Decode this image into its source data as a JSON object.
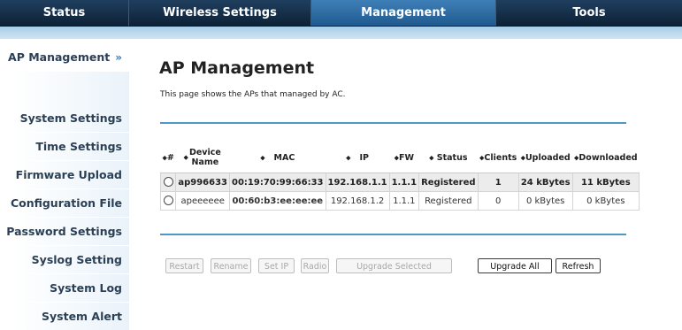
{
  "nav": {
    "tabs": [
      {
        "label": "Status"
      },
      {
        "label": "Wireless Settings"
      },
      {
        "label": "Management"
      },
      {
        "label": "Tools"
      }
    ]
  },
  "sidebar": {
    "chevron": "»",
    "items": [
      {
        "label": "AP Management"
      },
      {
        "label": "System Settings"
      },
      {
        "label": "Time Settings"
      },
      {
        "label": "Firmware Upload"
      },
      {
        "label": "Configuration File"
      },
      {
        "label": "Password Settings"
      },
      {
        "label": "Syslog Setting"
      },
      {
        "label": "System Log"
      },
      {
        "label": "System Alert"
      }
    ]
  },
  "main": {
    "title": "AP Management",
    "description": "This page shows the APs that managed by AC.",
    "sort_glyph": "◆",
    "table": {
      "headers": [
        "#",
        "Device Name",
        "MAC",
        "IP",
        "FW",
        "Status",
        "Clients",
        "Uploaded",
        "Downloaded"
      ],
      "rows": [
        {
          "device_name": "ap996633",
          "mac": "00:19:70:99:66:33",
          "ip": "192.168.1.1",
          "fw": "1.1.1",
          "status": "Registered",
          "clients": "1",
          "uploaded": "24 kBytes",
          "downloaded": "11 kBytes"
        },
        {
          "device_name": "apeeeeee",
          "mac": "00:60:b3:ee:ee:ee",
          "ip": "192.168.1.2",
          "fw": "1.1.1",
          "status": "Registered",
          "clients": "0",
          "uploaded": "0 kBytes",
          "downloaded": "0 kBytes"
        }
      ]
    },
    "buttons": {
      "restart": "Restart",
      "rename": "Rename",
      "set_ip": "Set IP",
      "radio": "Radio",
      "upgrade_selected": "Upgrade Selected",
      "upgrade_all": "Upgrade All",
      "refresh": "Refresh"
    }
  },
  "colors": {
    "nav_dark": "#0d2236",
    "nav_active": "#2f6fa8",
    "accent_rule": "#4d98c7",
    "band": "#b9d8ee"
  }
}
